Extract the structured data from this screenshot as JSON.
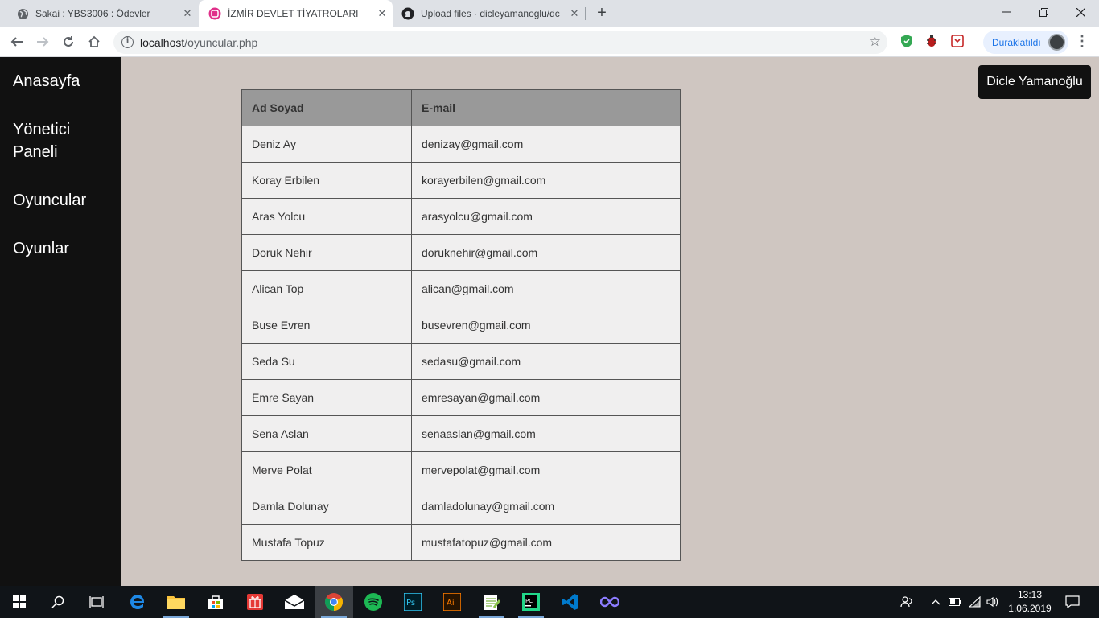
{
  "browser": {
    "tabs": [
      {
        "title": "Sakai : YBS3006 : Ödevler",
        "icon": "globe-icon"
      },
      {
        "title": "İZMİR DEVLET TİYATROLARI",
        "icon": "site-logo-icon"
      },
      {
        "title": "Upload files · dicleyamanoglu/dc",
        "icon": "github-icon"
      }
    ],
    "address": {
      "host": "localhost",
      "path": "/oyuncular.php"
    },
    "profile_label": "Duraklatıldı"
  },
  "sidebar": {
    "items": [
      {
        "label": "Anasayfa"
      },
      {
        "label": "Yönetici Paneli"
      },
      {
        "label": "Oyuncular"
      },
      {
        "label": "Oyunlar"
      }
    ]
  },
  "user": {
    "name": "Dicle Yamanoğlu"
  },
  "table": {
    "headers": [
      "Ad Soyad",
      "E-mail"
    ],
    "rows": [
      [
        "Deniz Ay",
        "denizay@gmail.com"
      ],
      [
        "Koray Erbilen",
        "korayerbilen@gmail.com"
      ],
      [
        "Aras Yolcu",
        "arasyolcu@gmail.com"
      ],
      [
        "Doruk Nehir",
        "doruknehir@gmail.com"
      ],
      [
        "Alican Top",
        "alican@gmail.com"
      ],
      [
        "Buse Evren",
        "busevren@gmail.com"
      ],
      [
        "Seda Su",
        "sedasu@gmail.com"
      ],
      [
        "Emre Sayan",
        "emresayan@gmail.com"
      ],
      [
        "Sena Aslan",
        "senaaslan@gmail.com"
      ],
      [
        "Merve Polat",
        "mervepolat@gmail.com"
      ],
      [
        "Damla Dolunay",
        "damladolunay@gmail.com"
      ],
      [
        "Mustafa Topuz",
        "mustafatopuz@gmail.com"
      ]
    ]
  },
  "taskbar": {
    "time": "13:13",
    "date": "1.06.2019"
  },
  "colors": {
    "sidebar": "#111111",
    "page_bg": "#cfc6c1",
    "header_bg": "#999999",
    "cell_bg": "#f0efef"
  }
}
